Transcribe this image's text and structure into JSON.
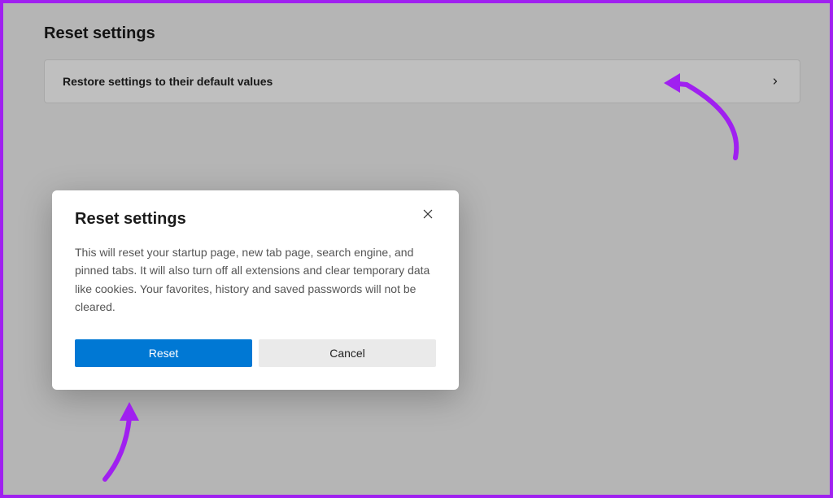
{
  "page": {
    "title": "Reset settings"
  },
  "restore": {
    "label": "Restore settings to their default values"
  },
  "dialog": {
    "title": "Reset settings",
    "body": "This will reset your startup page, new tab page, search engine, and pinned tabs. It will also turn off all extensions and clear temporary data like cookies. Your favorites, history and saved passwords will not be cleared.",
    "reset_label": "Reset",
    "cancel_label": "Cancel"
  }
}
